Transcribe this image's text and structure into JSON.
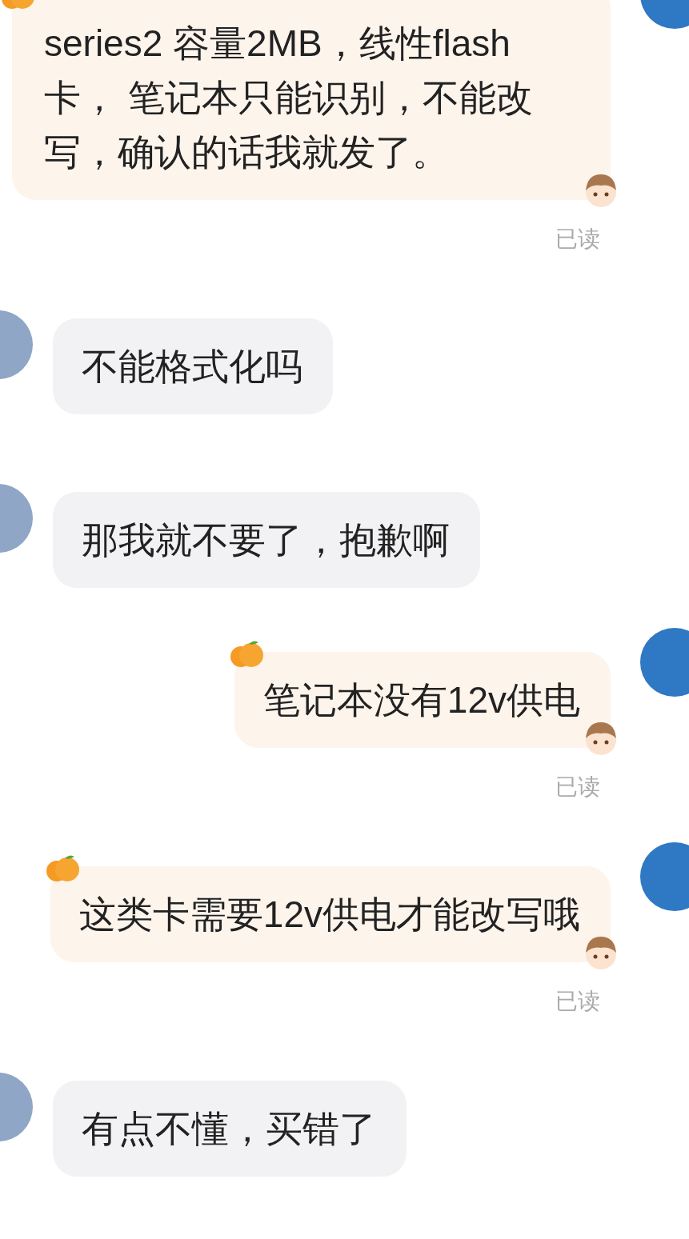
{
  "messages": [
    {
      "kind": "sent",
      "text": "series2 容量2MB，线性flash卡， 笔记本只能识别，不能改写，确认的话我就发了。",
      "read_receipt": "已读"
    },
    {
      "kind": "received",
      "text": "不能格式化吗"
    },
    {
      "kind": "received",
      "text": "那我就不要了，抱歉啊"
    },
    {
      "kind": "sent",
      "text": "笔记本没有12v供电",
      "read_receipt": "已读"
    },
    {
      "kind": "sent",
      "text": "这类卡需要12v供电才能改写哦",
      "read_receipt": "已读"
    },
    {
      "kind": "received",
      "text": "有点不懂，买错了"
    }
  ]
}
